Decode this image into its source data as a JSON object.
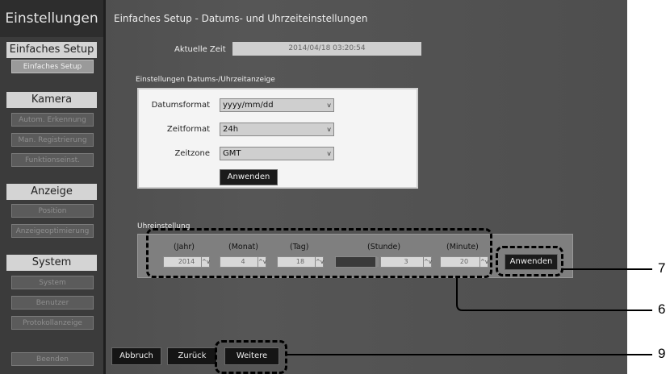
{
  "sidebar": {
    "title": "Einstellungen",
    "sections": [
      {
        "heading": "Einfaches Setup",
        "items": [
          "Einfaches Setup"
        ]
      },
      {
        "heading": "Kamera",
        "items": [
          "Autom. Erkennung",
          "Man. Registrierung",
          "Funktionseinst."
        ]
      },
      {
        "heading": "Anzeige",
        "items": [
          "Position",
          "Anzeigeoptimierung"
        ]
      },
      {
        "heading": "System",
        "items": [
          "System",
          "Benutzer",
          "Protokollanzeige"
        ]
      }
    ],
    "exit_label": "Beenden"
  },
  "main": {
    "title": "Einfaches Setup - Datums- und Uhrzeiteinstellungen",
    "current_time_label": "Aktuelle Zeit",
    "current_time_value": "2014/04/18 03:20:54",
    "display_section_label": "Einstellungen Datums-/Uhrzeitanzeige",
    "date_format_label": "Datumsformat",
    "date_format_value": "yyyy/mm/dd",
    "time_format_label": "Zeitformat",
    "time_format_value": "24h",
    "timezone_label": "Zeitzone",
    "timezone_value": "GMT",
    "apply_label": "Anwenden",
    "clock_section_label": "Uhreinstellung",
    "clock_headers": {
      "year": "(Jahr)",
      "month": "(Monat)",
      "day": "(Tag)",
      "hour": "(Stunde)",
      "minute": "(Minute)"
    },
    "clock_values": {
      "year": "2014",
      "month": "4",
      "day": "18",
      "hour": "3",
      "minute": "20"
    },
    "clock_apply_label": "Anwenden"
  },
  "footer": {
    "cancel_label": "Abbruch",
    "back_label": "Zurück",
    "next_label": "Weitere"
  },
  "callouts": {
    "apply": "7",
    "clock": "6",
    "next": "9"
  },
  "icons": {
    "dropdown": "v",
    "spinner": "^v"
  }
}
